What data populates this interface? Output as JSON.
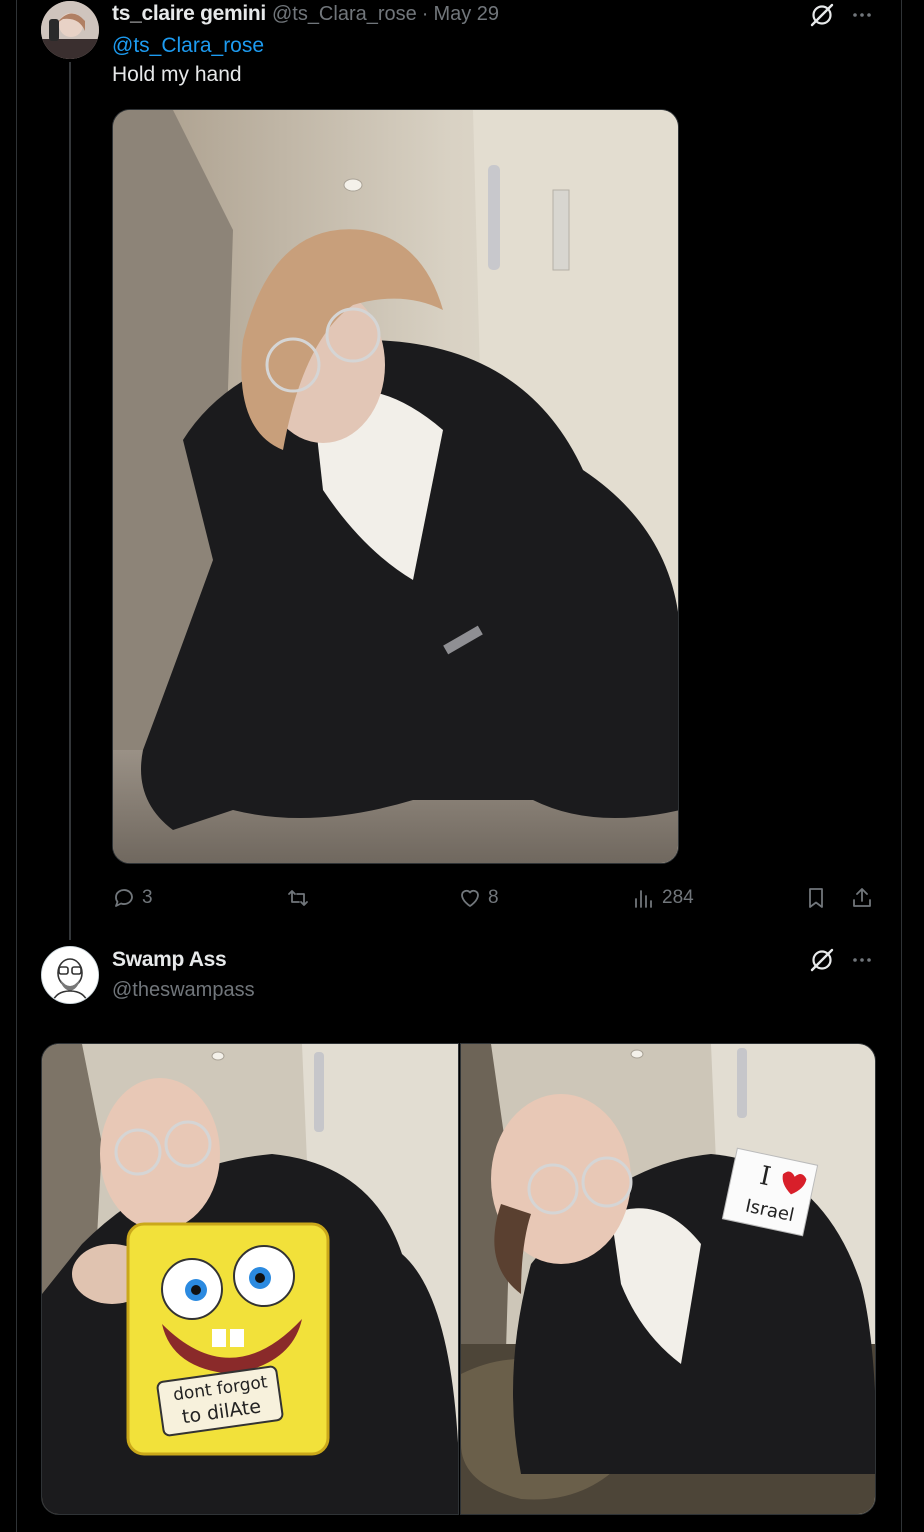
{
  "tweet1": {
    "display_name": "ts_claire gemini",
    "handle": "@ts_Clara_rose",
    "separator": "·",
    "date": "May 29",
    "mention": "@ts_Clara_rose",
    "text": "Hold my hand",
    "replies": "3",
    "retweets": "",
    "likes": "8",
    "views": "284"
  },
  "tweet2": {
    "display_name": "Swamp Ass",
    "handle": "@theswampass",
    "sign_text": [
      "dont forgot",
      "to dilAte"
    ],
    "note_text": [
      "I",
      "Israel"
    ]
  },
  "icons": {
    "grok": "grok-icon",
    "more": "more-icon",
    "reply": "reply-icon",
    "retweet": "retweet-icon",
    "like": "heart-icon",
    "views": "views-icon",
    "bookmark": "bookmark-icon",
    "share": "share-icon"
  },
  "colors": {
    "background": "#000000",
    "text": "#e7e9ea",
    "muted": "#71767b",
    "link": "#1d9bf0"
  }
}
